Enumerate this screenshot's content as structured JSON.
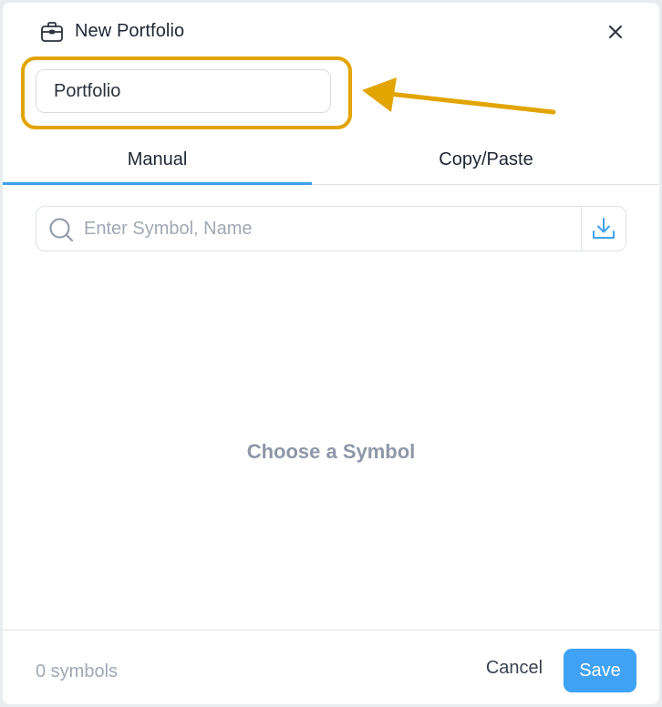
{
  "dialog": {
    "title": "New Portfolio",
    "title_icon": "briefcase-icon",
    "close_icon": "close-icon"
  },
  "name_field": {
    "value": "Portfolio"
  },
  "tabs": [
    {
      "label": "Manual",
      "active": true
    },
    {
      "label": "Copy/Paste",
      "active": false
    }
  ],
  "search": {
    "placeholder": "Enter Symbol, Name",
    "icon": "search-icon",
    "import_icon": "download-icon"
  },
  "empty_state": {
    "message": "Choose a Symbol"
  },
  "footer": {
    "symbol_count": "0 symbols",
    "cancel_label": "Cancel",
    "save_label": "Save"
  },
  "colors": {
    "accent": "#3fa2f5",
    "highlight": "#e2a400",
    "muted_text": "#a1a8b4"
  }
}
